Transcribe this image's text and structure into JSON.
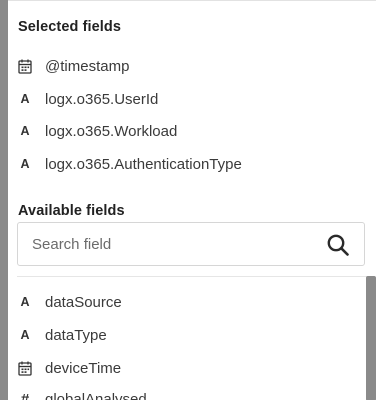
{
  "selected_section": {
    "title": "Selected fields",
    "fields": [
      {
        "type": "date",
        "icon": "calendar-icon",
        "name": "@timestamp"
      },
      {
        "type": "string",
        "icon": "letter-a-icon",
        "type_label": "A",
        "name": "logx.o365.UserId"
      },
      {
        "type": "string",
        "icon": "letter-a-icon",
        "type_label": "A",
        "name": "logx.o365.Workload"
      },
      {
        "type": "string",
        "icon": "letter-a-icon",
        "type_label": "A",
        "name": "logx.o365.AuthenticationType"
      }
    ]
  },
  "available_section": {
    "title": "Available fields",
    "search": {
      "placeholder": "Search field",
      "value": ""
    },
    "fields": [
      {
        "type": "string",
        "icon": "letter-a-icon",
        "type_label": "A",
        "name": "dataSource"
      },
      {
        "type": "string",
        "icon": "letter-a-icon",
        "type_label": "A",
        "name": "dataType"
      },
      {
        "type": "date",
        "icon": "calendar-icon",
        "name": "deviceTime"
      },
      {
        "type": "number",
        "icon": "hash-icon",
        "type_label": "#",
        "name": "globalAnalysed"
      }
    ]
  },
  "colors": {
    "side_strip": "#8a8a8a",
    "text": "#3a3a3a",
    "title": "#222222",
    "border": "#d6d6d6"
  }
}
